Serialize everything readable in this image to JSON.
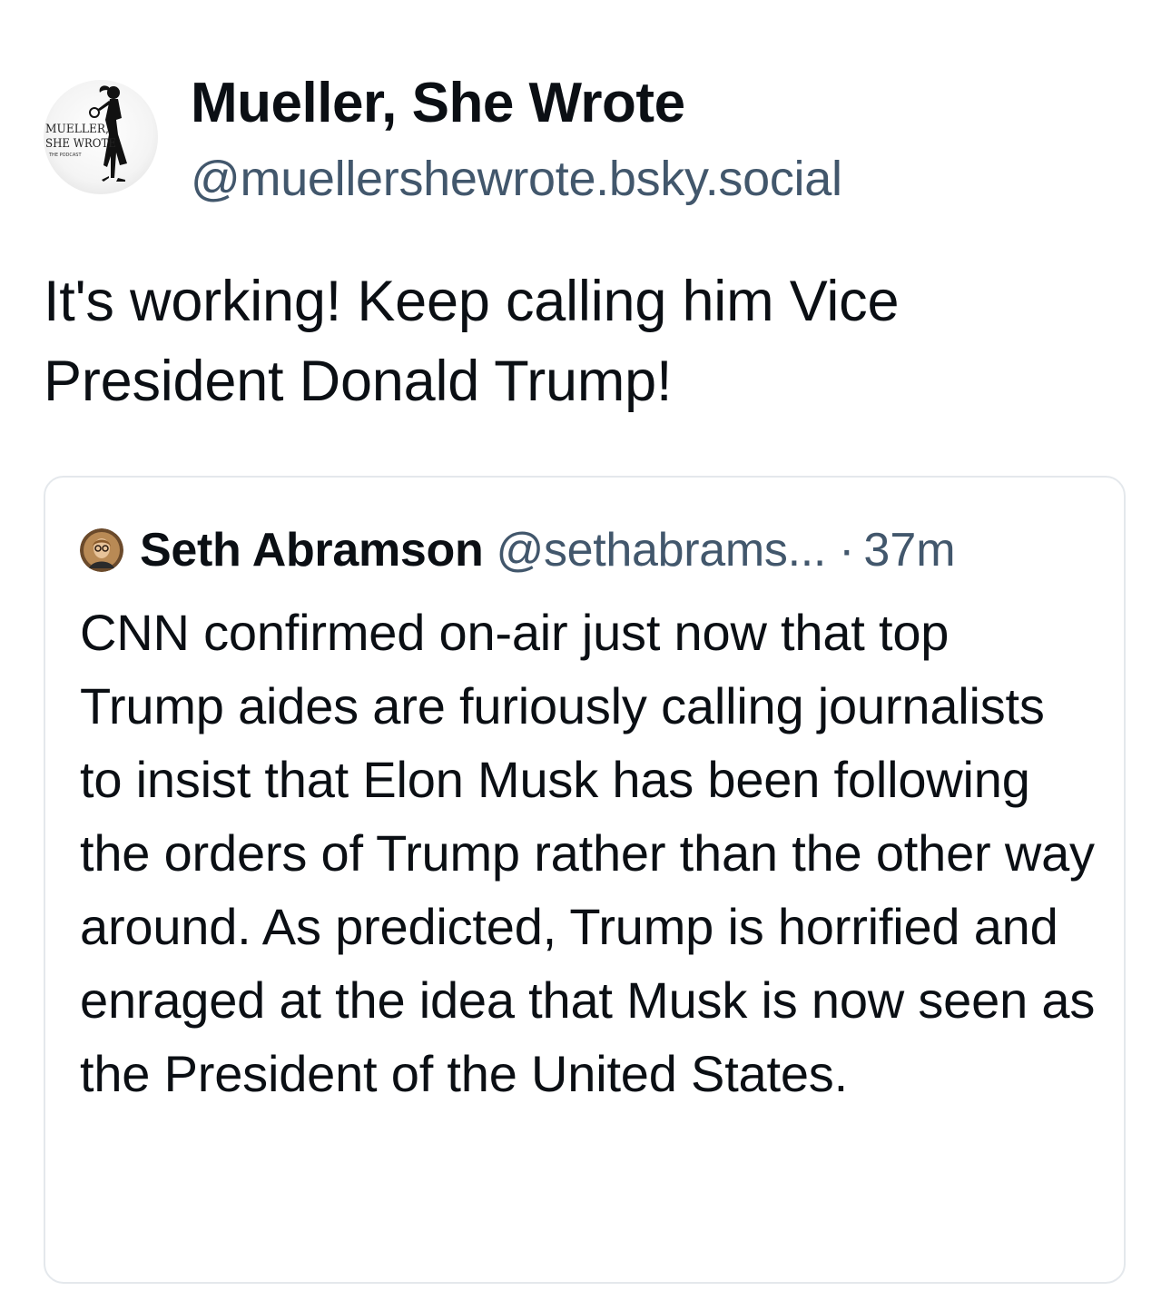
{
  "post": {
    "author": {
      "display_name": "Mueller, She Wrote",
      "handle": "@muellershewrote.bsky.social",
      "avatar_logo_text": "MUELLER, SHE WROTE THE PODCAST"
    },
    "text": "It's working! Keep calling him Vice President Donald Trump!"
  },
  "quote": {
    "author": {
      "display_name": "Seth Abramson",
      "handle": "@sethabrams..."
    },
    "separator": "·",
    "time": "37m",
    "text": "CNN confirmed on-air just now that top Trump aides are furiously calling journalists to insist that Elon Musk has been following the orders of Trump rather than the other way around. As predicted, Trump is horrified and enraged at the idea that Musk is now seen as the President of the United States."
  },
  "colors": {
    "text": "#0b0f14",
    "muted": "#42576c",
    "border": "#e4e8ec"
  }
}
